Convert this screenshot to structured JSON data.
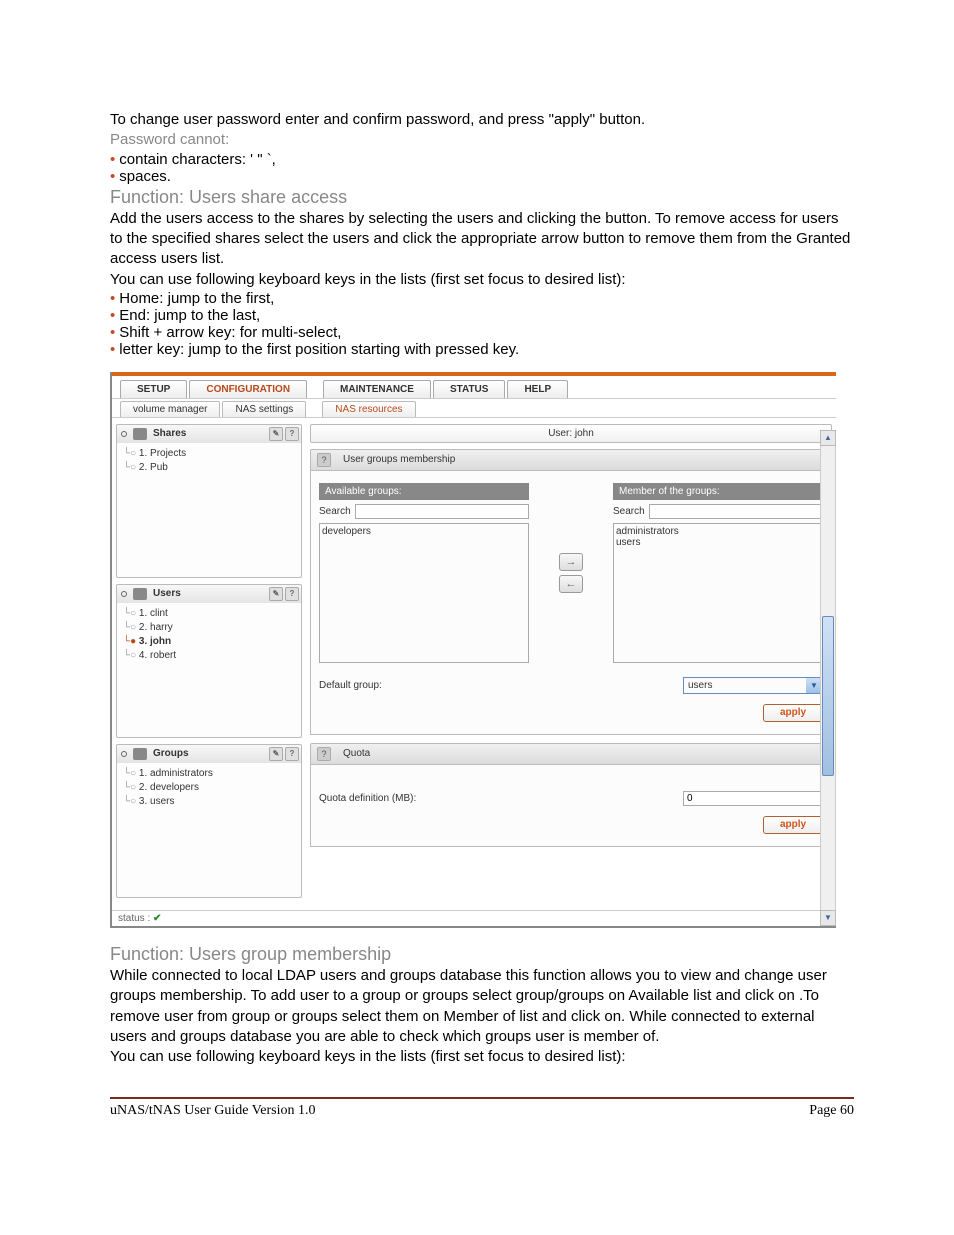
{
  "intro": {
    "line1": "To change user password enter and confirm password, and press \"apply\" button.",
    "cannot": "Password cannot:",
    "bullets": [
      "contain characters: ' \" `,",
      "spaces."
    ]
  },
  "shareAccess": {
    "heading": "Function: Users share access",
    "p1": "Add the users access to the shares by selecting the users and clicking the button. To remove access for users to the specified shares select the users and click the appropriate arrow button to remove them from the Granted access users list.",
    "p2": "You can use following keyboard keys in the lists (first set focus to desired list):",
    "bullets": [
      "Home: jump to the first,",
      "End: jump to the last,",
      "Shift + arrow key: for multi-select,",
      "letter key: jump to the first position starting with pressed key."
    ]
  },
  "shot": {
    "tabs": [
      "SETUP",
      "CONFIGURATION",
      "MAINTENANCE",
      "STATUS",
      "HELP"
    ],
    "subtabs_left": [
      "volume manager",
      "NAS settings"
    ],
    "subtabs_right": [
      "NAS resources"
    ],
    "sidebar": {
      "shares": {
        "title": "Shares",
        "items": [
          "1. Projects",
          "2. Pub"
        ]
      },
      "users": {
        "title": "Users",
        "items": [
          "1. clint",
          "2. harry",
          "3. john",
          "4. robert"
        ],
        "selected": 2
      },
      "groups": {
        "title": "Groups",
        "items": [
          "1. administrators",
          "2. developers",
          "3. users"
        ]
      }
    },
    "main": {
      "user_title": "User: john",
      "membership": {
        "section": "User groups membership",
        "avail_label": "Available groups:",
        "member_label": "Member of the groups:",
        "search_label": "Search",
        "available": [
          "developers"
        ],
        "members": [
          "administrators",
          "users"
        ],
        "default_label": "Default group:",
        "default_value": "users",
        "apply": "apply"
      },
      "quota": {
        "section": "Quota",
        "label": "Quota definition (MB):",
        "value": "0",
        "apply": "apply"
      }
    },
    "status": "status :"
  },
  "groupMembership": {
    "heading": "Function: Users group membership",
    "p1": "While connected to local LDAP users and groups database this function allows you to view and change user groups membership. To add user to a group or groups select group/groups on Available list and click on .To remove user from group or groups select them on Member of list and click on.  While connected to external users and groups database you are able to check which groups user is member of.",
    "p2": "You can use following keyboard keys in the lists (first set focus to desired list):"
  },
  "footer": {
    "left": "uNAS/tNAS User Guide Version 1.0",
    "right": "Page 60"
  }
}
